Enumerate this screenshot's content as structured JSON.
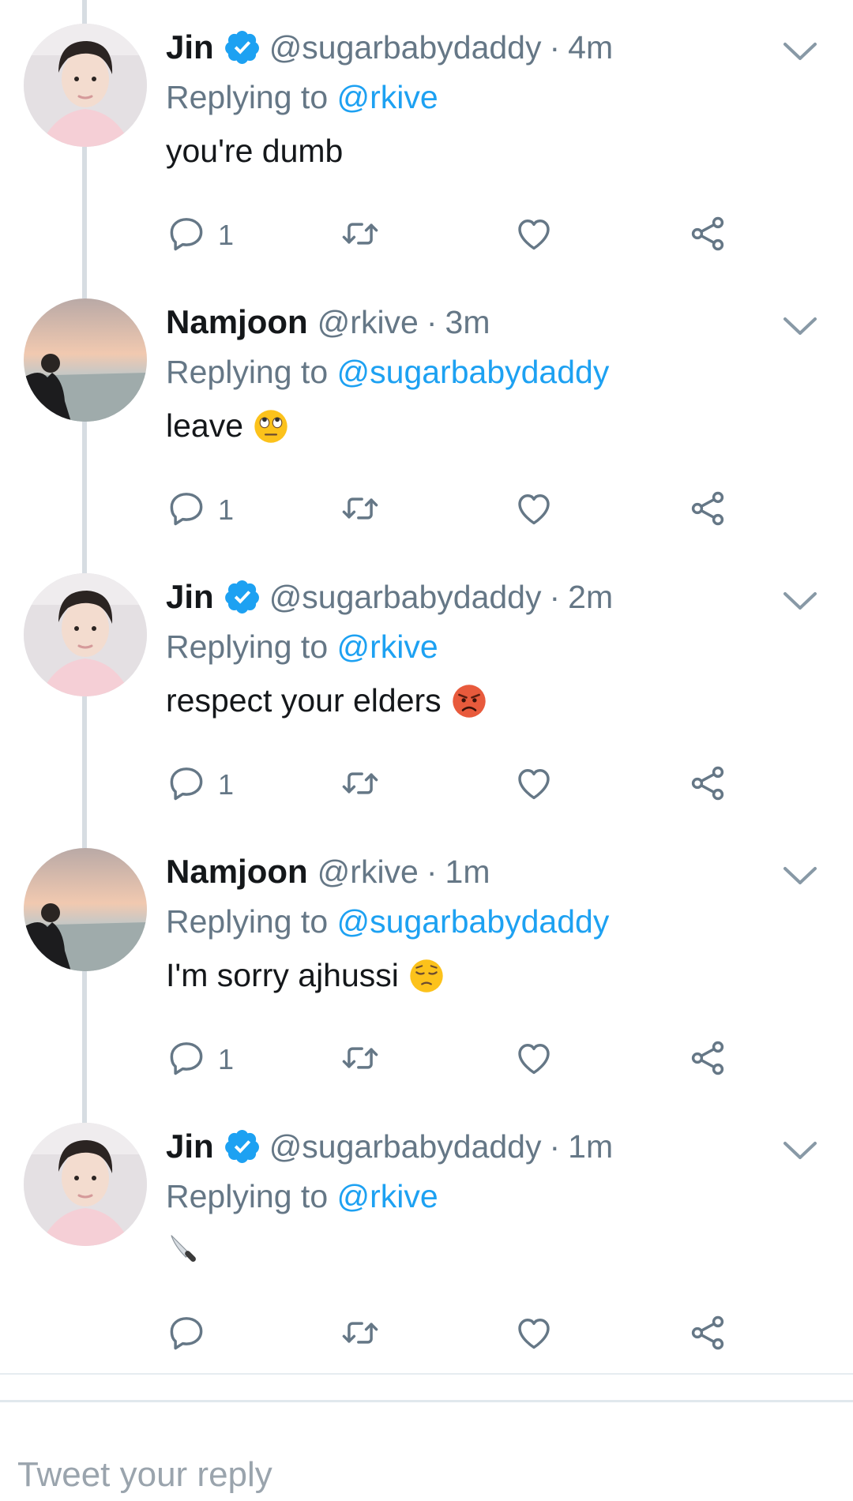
{
  "colors": {
    "accent": "#1da1f2",
    "secondary_text": "#657786",
    "primary_text": "#14171a",
    "thread_line": "#d7dde2"
  },
  "tweets": [
    {
      "name": "Jin",
      "verified": true,
      "handle": "@sugarbabydaddy",
      "time": "4m",
      "replying_prefix": "Replying to",
      "replying_to": "@rkive",
      "text": "you're dumb",
      "emoji": "",
      "reply_count": "1",
      "avatar": "jin"
    },
    {
      "name": "Namjoon",
      "verified": false,
      "handle": "@rkive",
      "time": "3m",
      "replying_prefix": "Replying to",
      "replying_to": "@sugarbabydaddy",
      "text": "leave",
      "emoji": "face-with-rolling-eyes",
      "reply_count": "1",
      "avatar": "namjoon"
    },
    {
      "name": "Jin",
      "verified": true,
      "handle": "@sugarbabydaddy",
      "time": "2m",
      "replying_prefix": "Replying to",
      "replying_to": "@rkive",
      "text": "respect your elders",
      "emoji": "pouting-face",
      "reply_count": "1",
      "avatar": "jin"
    },
    {
      "name": "Namjoon",
      "verified": false,
      "handle": "@rkive",
      "time": "1m",
      "replying_prefix": "Replying to",
      "replying_to": "@sugarbabydaddy",
      "text": "I'm sorry ajhussi",
      "emoji": "pensive-face",
      "reply_count": "1",
      "avatar": "namjoon"
    },
    {
      "name": "Jin",
      "verified": true,
      "handle": "@sugarbabydaddy",
      "time": "1m",
      "replying_prefix": "Replying to",
      "replying_to": "@rkive",
      "text": "",
      "emoji": "kitchen-knife",
      "reply_count": "",
      "avatar": "jin"
    }
  ],
  "compose": {
    "placeholder": "Tweet your reply"
  }
}
